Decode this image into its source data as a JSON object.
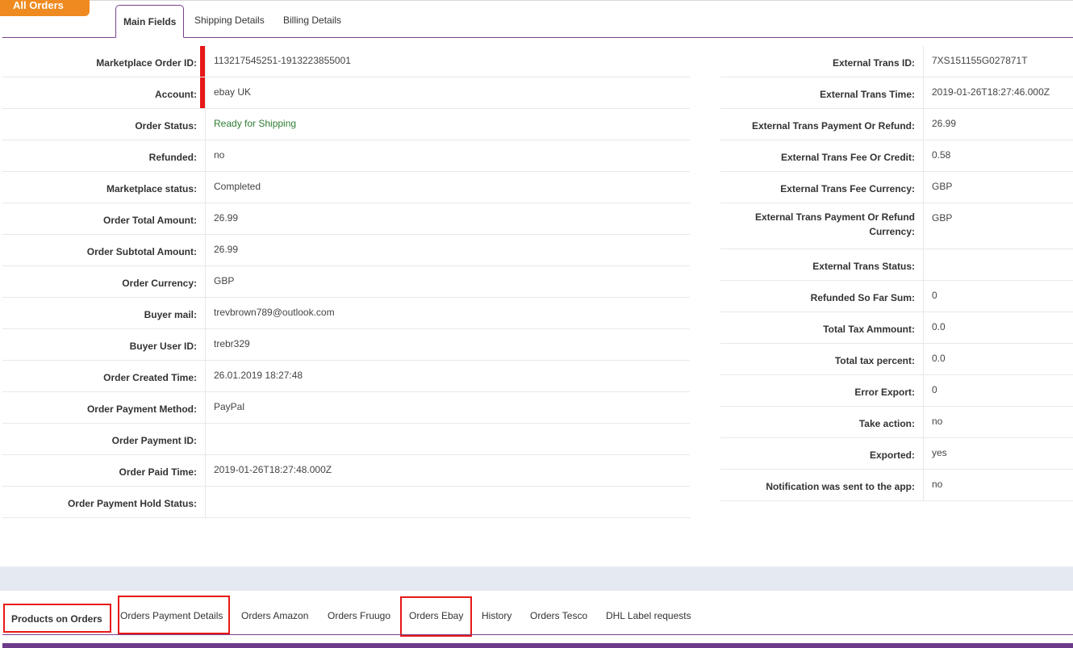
{
  "header": {
    "title": "All Orders"
  },
  "top_tabs": [
    {
      "label": "Main Fields",
      "active": true
    },
    {
      "label": "Shipping Details",
      "active": false
    },
    {
      "label": "Billing Details",
      "active": false
    }
  ],
  "left_fields": [
    {
      "label": "Marketplace Order ID:",
      "value": "113217545251-1913223855001"
    },
    {
      "label": "Account:",
      "value": "ebay UK"
    },
    {
      "label": "Order Status:",
      "value": "Ready for Shipping"
    },
    {
      "label": "Refunded:",
      "value": "no"
    },
    {
      "label": "Marketplace status:",
      "value": "Completed"
    },
    {
      "label": "Order Total Amount:",
      "value": "26.99"
    },
    {
      "label": "Order Subtotal Amount:",
      "value": "26.99"
    },
    {
      "label": "Order Currency:",
      "value": "GBP"
    },
    {
      "label": "Buyer mail:",
      "value": "trevbrown789@outlook.com"
    },
    {
      "label": "Buyer User ID:",
      "value": "trebr329"
    },
    {
      "label": "Order Created Time:",
      "value": "26.01.2019 18:27:48"
    },
    {
      "label": "Order Payment Method:",
      "value": "PayPal"
    },
    {
      "label": "Order Payment ID:",
      "value": ""
    },
    {
      "label": "Order Paid Time:",
      "value": "2019-01-26T18:27:48.000Z"
    },
    {
      "label": "Order Payment Hold Status:",
      "value": ""
    }
  ],
  "right_fields": [
    {
      "label": "External Trans ID:",
      "value": "7XS151155G027871T"
    },
    {
      "label": "External Trans Time:",
      "value": "2019-01-26T18:27:46.000Z"
    },
    {
      "label": "External Trans Payment Or Refund:",
      "value": "26.99"
    },
    {
      "label": "External Trans Fee Or Credit:",
      "value": "0.58"
    },
    {
      "label": "External Trans Fee Currency:",
      "value": "GBP"
    },
    {
      "label": "External Trans Payment Or Refund Currency:",
      "value": "GBP"
    },
    {
      "label": "External Trans Status:",
      "value": ""
    },
    {
      "label": "Refunded So Far Sum:",
      "value": "0"
    },
    {
      "label": "Total Tax Ammount:",
      "value": "0.0"
    },
    {
      "label": "Total tax percent:",
      "value": "0.0"
    },
    {
      "label": "Error Export:",
      "value": "0"
    },
    {
      "label": "Take action:",
      "value": "no"
    },
    {
      "label": "Exported:",
      "value": "yes"
    },
    {
      "label": "Notification was sent to the app:",
      "value": "no"
    }
  ],
  "bottom_tabs": [
    {
      "label": "Products on Orders",
      "active": true
    },
    {
      "label": "Orders Payment Details",
      "active": false
    },
    {
      "label": "Orders Amazon",
      "active": false
    },
    {
      "label": "Orders Fruugo",
      "active": false
    },
    {
      "label": "Orders Ebay",
      "active": false
    },
    {
      "label": "History",
      "active": false
    },
    {
      "label": "Orders Tesco",
      "active": false
    },
    {
      "label": "DHL Label requests",
      "active": false
    }
  ],
  "colors": {
    "accent_orange": "#ee8a1f",
    "tab_purple": "#7b3f8c",
    "status_green": "#2e7d32",
    "highlight_red": "#e81818"
  }
}
